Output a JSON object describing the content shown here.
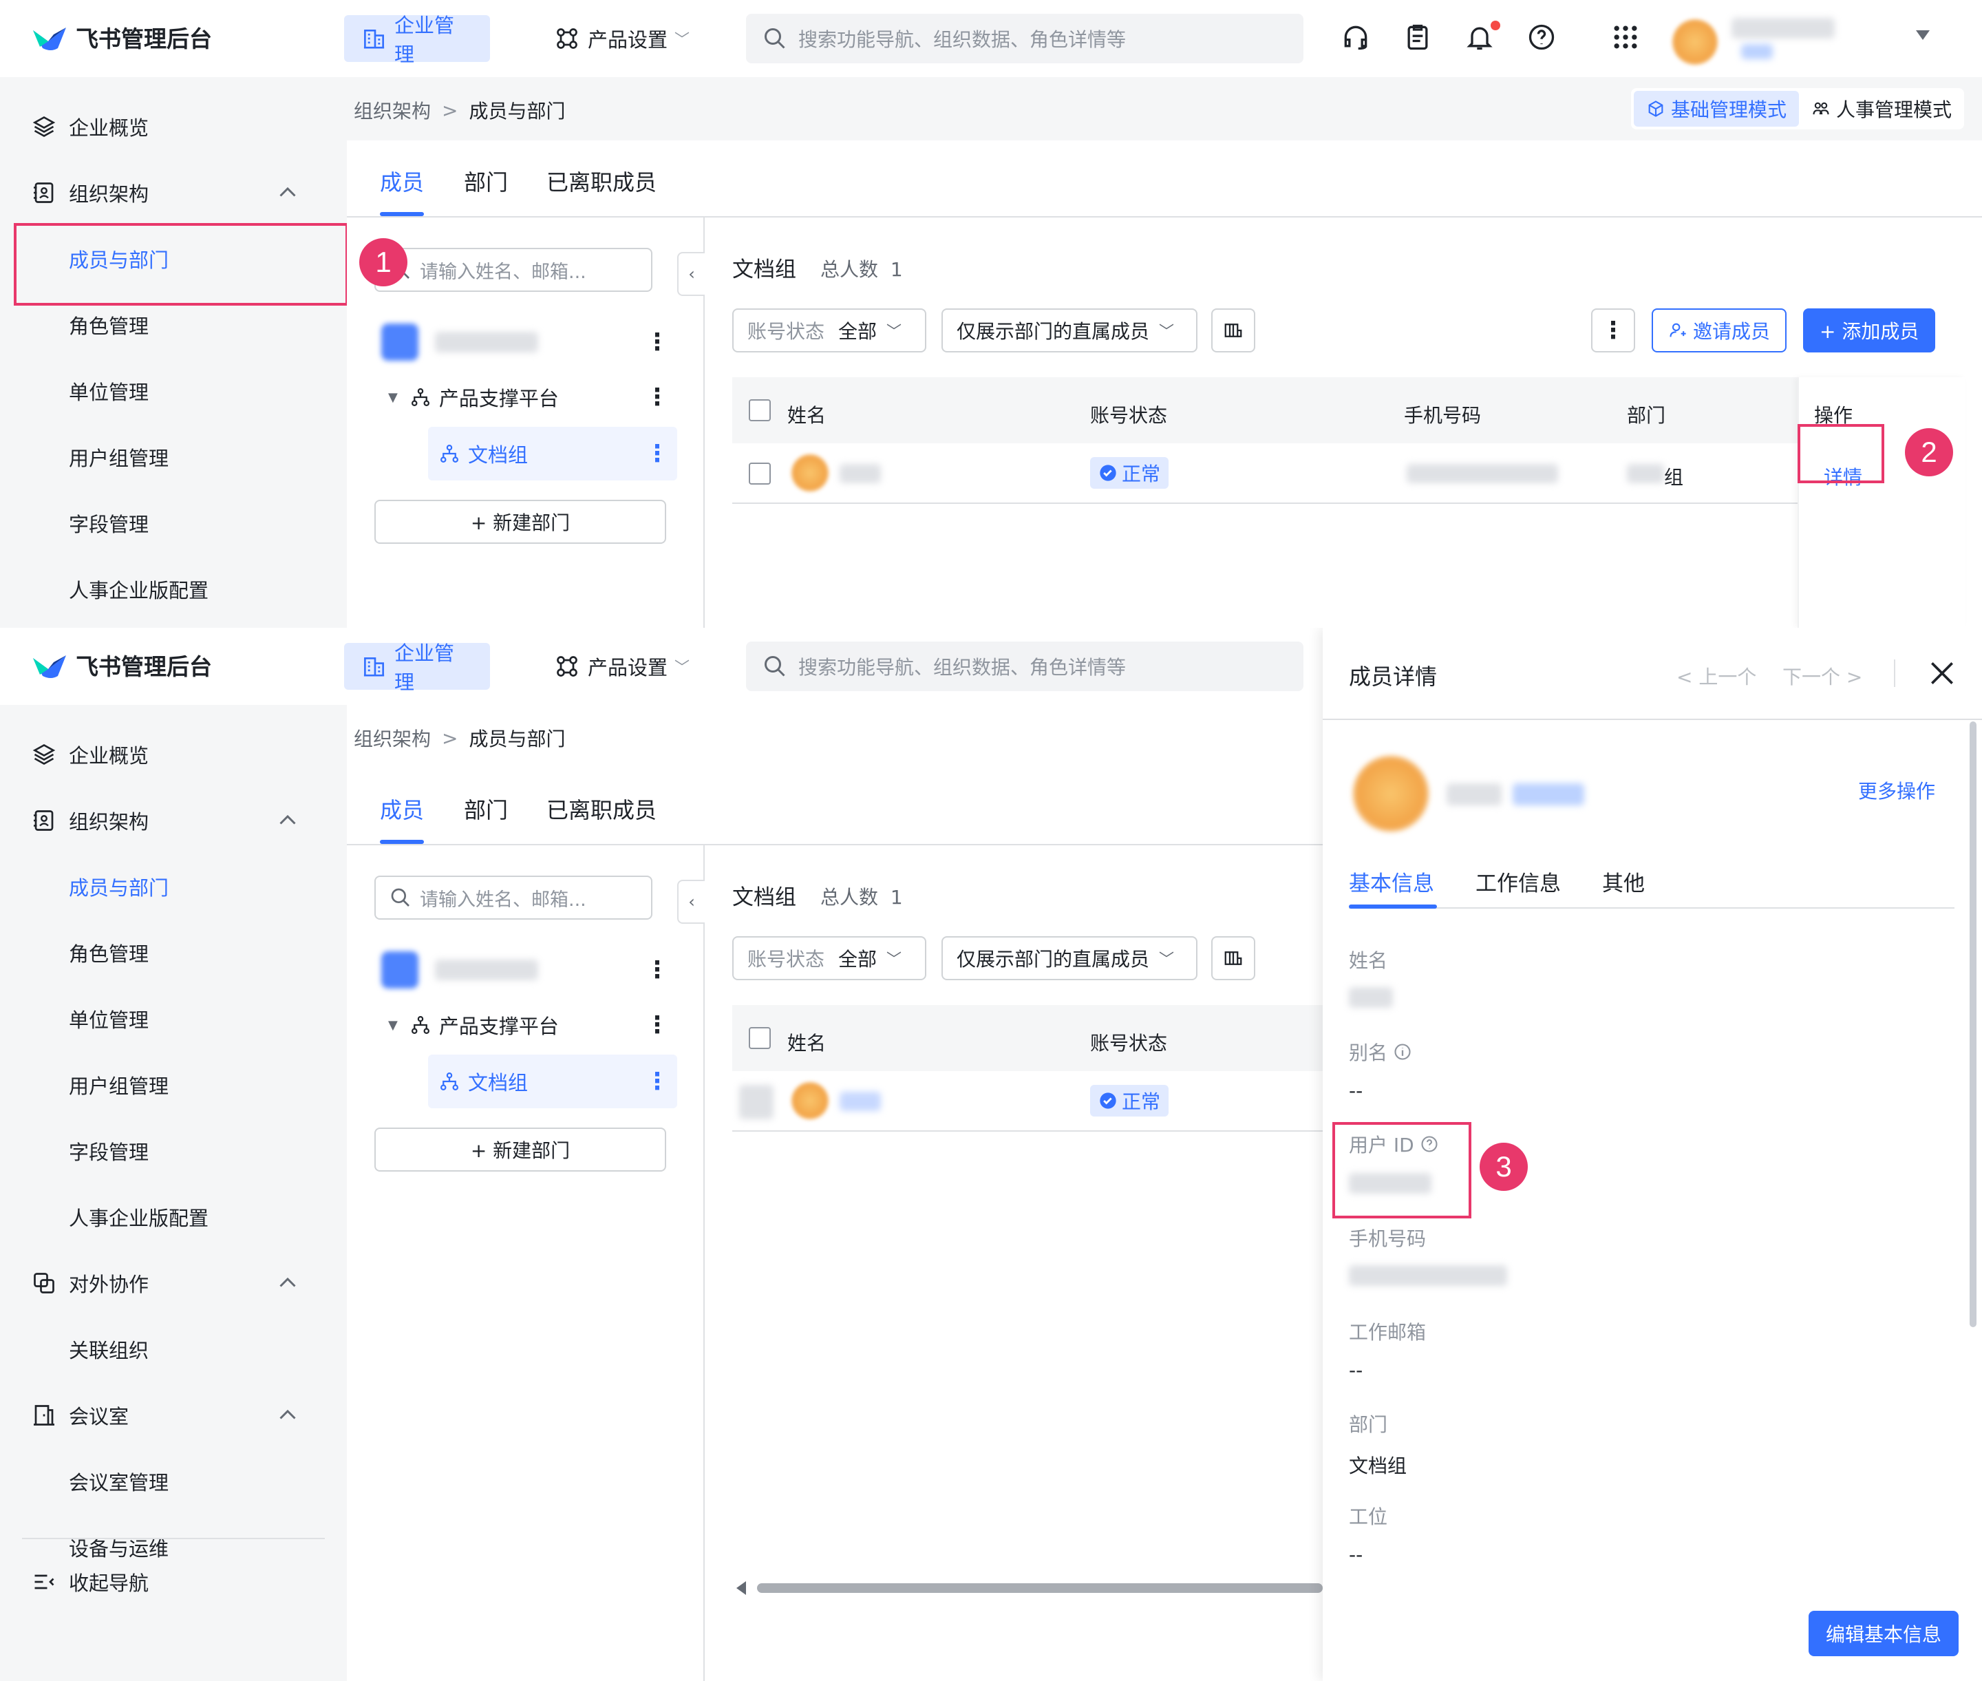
{
  "app": {
    "title": "飞书管理后台"
  },
  "topnav": {
    "enterprise": "企业管理",
    "product": "产品设置",
    "search_placeholder": "搜索功能导航、组织数据、角色详情等"
  },
  "sidebar": {
    "overview": "企业概览",
    "org": "组织架构",
    "members": "成员与部门",
    "roles": "角色管理",
    "units": "单位管理",
    "usergroups": "用户组管理",
    "fields": "字段管理",
    "hr_config": "人事企业版配置",
    "external": "对外协作",
    "linked_org": "关联组织",
    "meeting": "会议室",
    "meeting_mgmt": "会议室管理",
    "devices": "设备与运维",
    "collapse": "收起导航"
  },
  "breadcrumb": {
    "parent": "组织架构",
    "current": "成员与部门",
    "sep": ">"
  },
  "modes": {
    "basic": "基础管理模式",
    "hr": "人事管理模式"
  },
  "tabs": {
    "members": "成员",
    "departments": "部门",
    "departed": "已离职成员"
  },
  "tree": {
    "search_placeholder": "请输入姓名、邮箱...",
    "platform": "产品支撑平台",
    "docs": "文档组",
    "new_dept": "+ 新建部门"
  },
  "group": {
    "title": "文档组",
    "count_label": "总人数",
    "count": "1"
  },
  "filters": {
    "status_label": "账号状态",
    "status_value": "全部",
    "direct_only": "仅展示部门的直属成员"
  },
  "actions": {
    "invite": "邀请成员",
    "add": "+ 添加成员"
  },
  "table": {
    "headers": {
      "name": "姓名",
      "status": "账号状态",
      "phone": "手机号码",
      "dept": "部门",
      "ops": "操作"
    },
    "row": {
      "status": "正常",
      "dept_tail": "组",
      "detail": "详情"
    }
  },
  "markers": {
    "m1": "1",
    "m2": "2",
    "m3": "3"
  },
  "drawer": {
    "title": "成员详情",
    "prev": "< 上一个",
    "next": "下一个 >",
    "more": "更多操作",
    "tabs": {
      "basic": "基本信息",
      "work": "工作信息",
      "other": "其他"
    },
    "fields": {
      "name": "姓名",
      "alias": "别名",
      "alias_value": "--",
      "user_id": "用户 ID",
      "phone": "手机号码",
      "email": "工作邮箱",
      "email_value": "--",
      "dept": "部门",
      "dept_value": "文档组",
      "seat": "工位",
      "seat_value": "--"
    },
    "edit": "编辑基本信息"
  },
  "colors": {
    "accent": "#3370ff",
    "marker": "#e8386b",
    "sidebar_bg": "#f5f6f7"
  }
}
